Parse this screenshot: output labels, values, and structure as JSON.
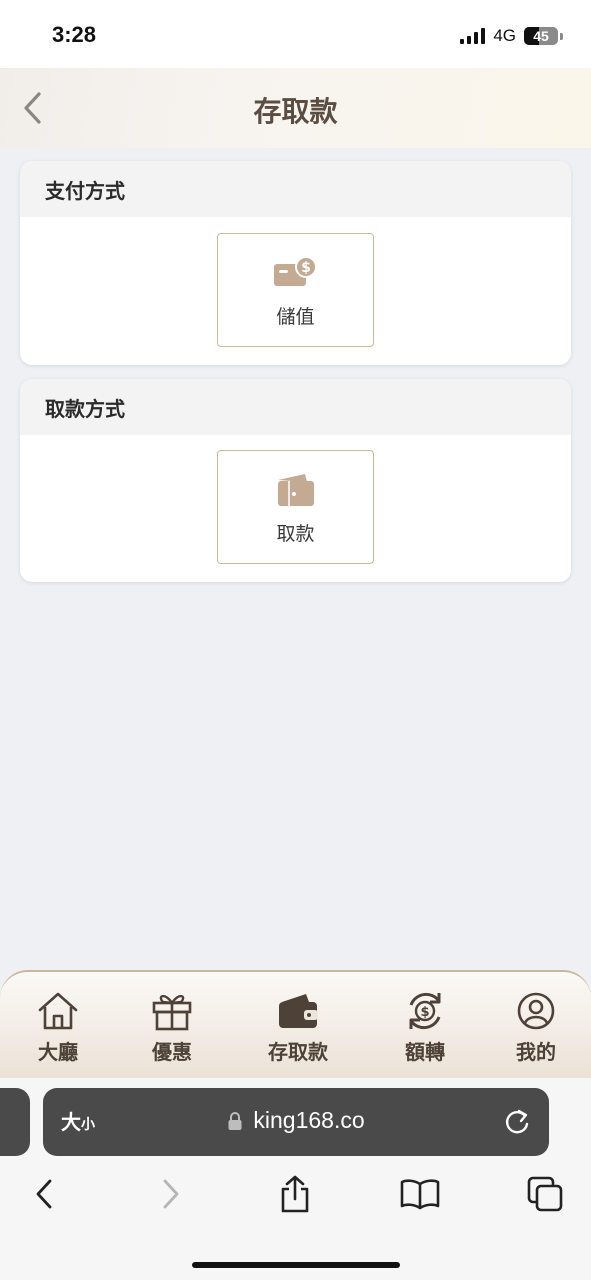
{
  "status_bar": {
    "time": "3:28",
    "network": "4G",
    "battery": "45"
  },
  "header": {
    "title": "存取款"
  },
  "payment_section": {
    "title": "支付方式",
    "option_label": "儲值"
  },
  "withdraw_section": {
    "title": "取款方式",
    "option_label": "取款"
  },
  "tabbar": {
    "items": [
      {
        "label": "大廳",
        "icon": "home-icon"
      },
      {
        "label": "優惠",
        "icon": "gift-icon"
      },
      {
        "label": "存取款",
        "icon": "wallet-icon"
      },
      {
        "label": "額轉",
        "icon": "transfer-icon"
      },
      {
        "label": "我的",
        "icon": "user-icon"
      }
    ]
  },
  "browser": {
    "aa_large": "大",
    "aa_small": "小",
    "url": "king168.co"
  },
  "colors": {
    "accent": "#c9b79d",
    "icon_fill": "#c4a993",
    "title_text": "#5b4d42"
  }
}
